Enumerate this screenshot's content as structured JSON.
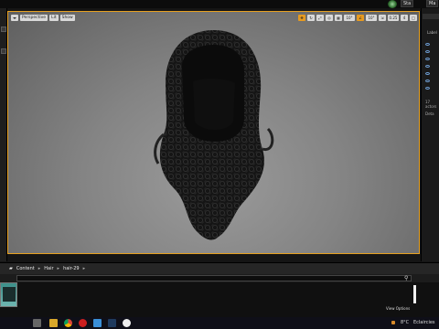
{
  "top_bar": {
    "btn1": "Sta",
    "btn2": "Ma"
  },
  "viewport": {
    "perspective": "Perspective",
    "lit": "Lit",
    "show": "Show",
    "grid_snap": "10°",
    "angle_snap": "10°",
    "scale_snap": "0.25",
    "cam_speed": "4"
  },
  "right_panel": {
    "label": "Label",
    "count": "17 actors",
    "details": "Deta"
  },
  "content_browser": {
    "breadcrumb": [
      "Content",
      "Hair",
      "hair-29"
    ],
    "view_options": "View Options"
  },
  "taskbar": {
    "temp": "8°C",
    "weather": "Eclaircies"
  },
  "colors": {
    "accent_orange": "#e6a020",
    "hair": "#141414"
  }
}
